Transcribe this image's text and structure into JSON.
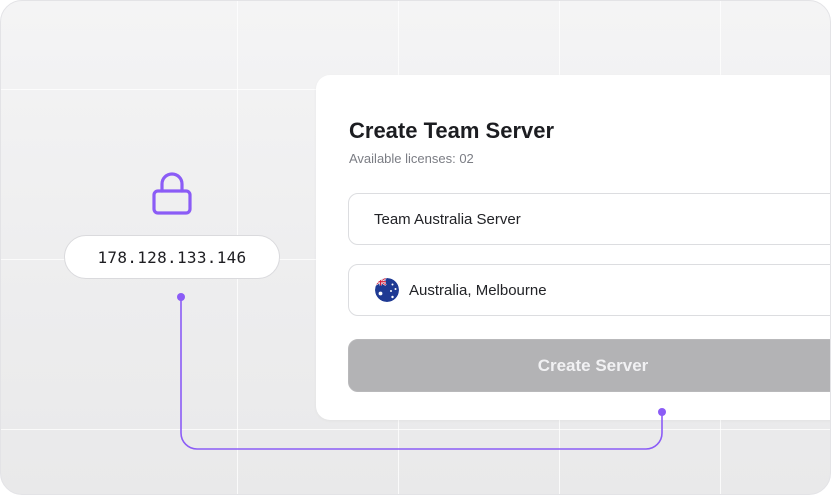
{
  "ip_address": "178.128.133.146",
  "card": {
    "title": "Create Team Server",
    "subtitle": "Available licenses: 02",
    "server_name_value": "Team Australia Server",
    "location_value": "Australia, Melbourne",
    "location_flag_icon": "australia-flag-icon",
    "create_button_label": "Create Server"
  },
  "colors": {
    "accent": "#8b5cf6",
    "button_disabled": "#b3b3b5"
  }
}
